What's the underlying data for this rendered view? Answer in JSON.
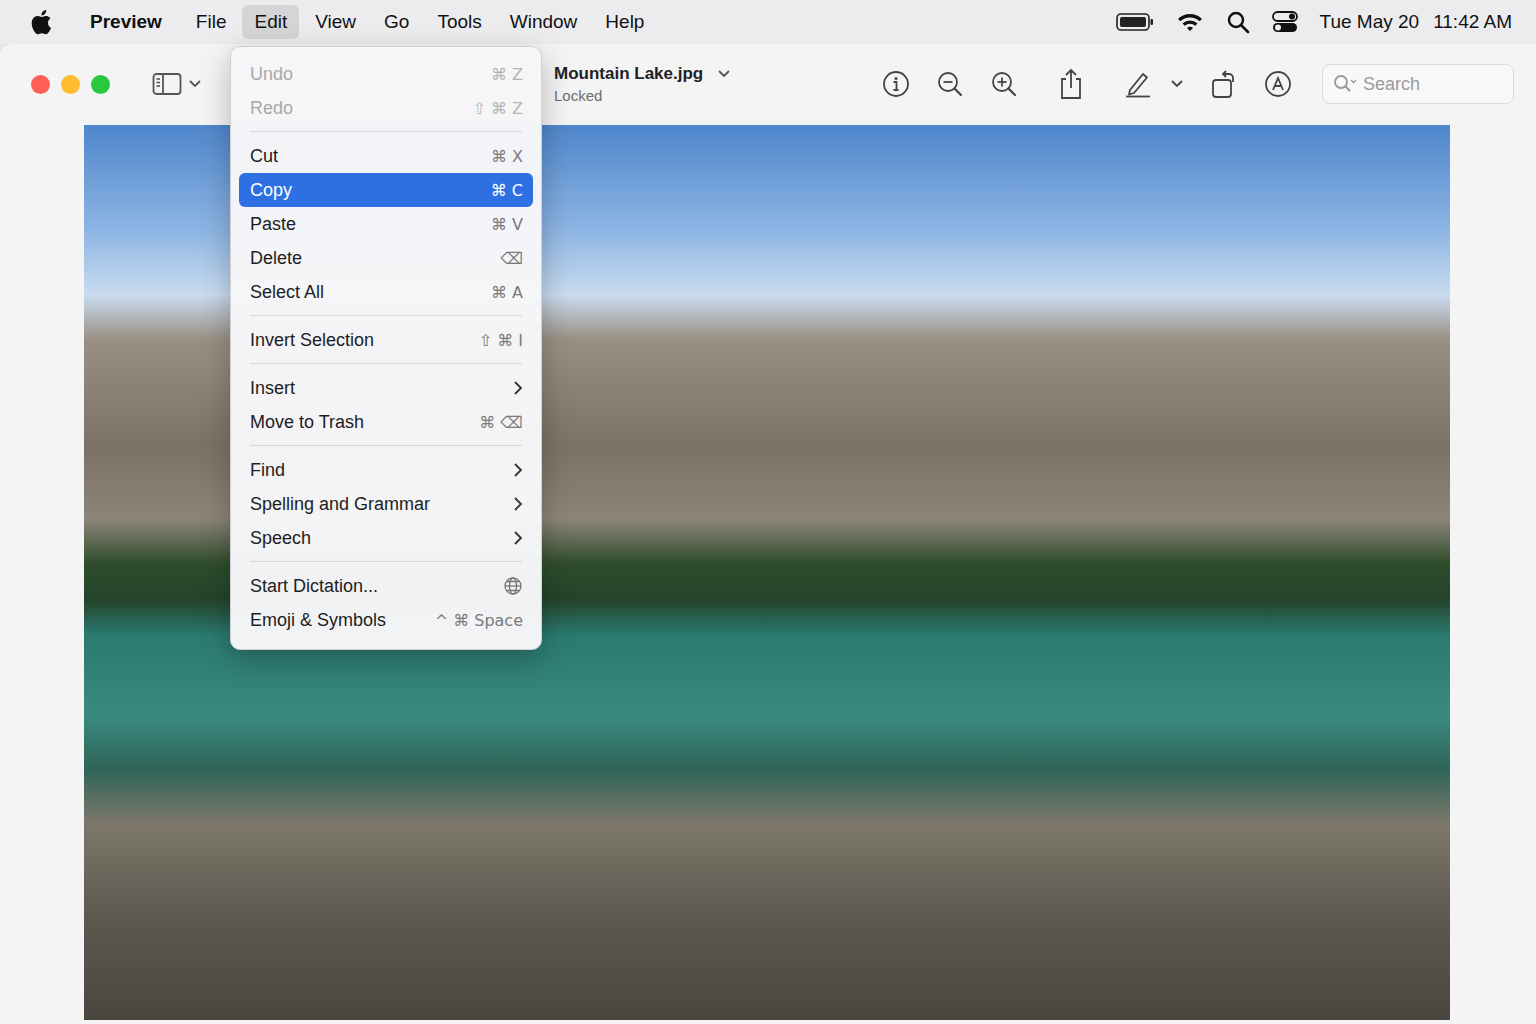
{
  "menubar": {
    "items": [
      {
        "label": "Preview",
        "bold": true,
        "selected": false
      },
      {
        "label": "File",
        "bold": false,
        "selected": false
      },
      {
        "label": "Edit",
        "bold": false,
        "selected": true
      },
      {
        "label": "View",
        "bold": false,
        "selected": false
      },
      {
        "label": "Go",
        "bold": false,
        "selected": false
      },
      {
        "label": "Tools",
        "bold": false,
        "selected": false
      },
      {
        "label": "Window",
        "bold": false,
        "selected": false
      },
      {
        "label": "Help",
        "bold": false,
        "selected": false
      }
    ],
    "date": "Tue May 20",
    "time": "11:42 AM"
  },
  "window": {
    "title": "Mountain Lake.jpg",
    "subtitle": "Locked"
  },
  "search": {
    "placeholder": "Search"
  },
  "menu": {
    "groups": [
      [
        {
          "label": "Undo",
          "shortcut": "⌘ Z",
          "kind": "shortcut",
          "disabled": true,
          "selected": false
        },
        {
          "label": "Redo",
          "shortcut": "⇧ ⌘ Z",
          "kind": "shortcut",
          "disabled": true,
          "selected": false
        }
      ],
      [
        {
          "label": "Cut",
          "shortcut": "⌘ X",
          "kind": "shortcut",
          "disabled": false,
          "selected": false
        },
        {
          "label": "Copy",
          "shortcut": "⌘ C",
          "kind": "shortcut",
          "disabled": false,
          "selected": true
        },
        {
          "label": "Paste",
          "shortcut": "⌘ V",
          "kind": "shortcut",
          "disabled": false,
          "selected": false
        },
        {
          "label": "Delete",
          "shortcut": "⌫",
          "kind": "shortcut",
          "disabled": false,
          "selected": false
        },
        {
          "label": "Select All",
          "shortcut": "⌘ A",
          "kind": "shortcut",
          "disabled": false,
          "selected": false
        }
      ],
      [
        {
          "label": "Invert Selection",
          "shortcut": "⇧ ⌘ I",
          "kind": "shortcut",
          "disabled": false,
          "selected": false
        }
      ],
      [
        {
          "label": "Insert",
          "shortcut": "",
          "kind": "submenu",
          "disabled": false,
          "selected": false
        },
        {
          "label": "Move to Trash",
          "shortcut": "⌘ ⌫",
          "kind": "shortcut",
          "disabled": false,
          "selected": false
        }
      ],
      [
        {
          "label": "Find",
          "shortcut": "",
          "kind": "submenu",
          "disabled": false,
          "selected": false
        },
        {
          "label": "Spelling and Grammar",
          "shortcut": "",
          "kind": "submenu",
          "disabled": false,
          "selected": false
        },
        {
          "label": "Speech",
          "shortcut": "",
          "kind": "submenu",
          "disabled": false,
          "selected": false
        }
      ],
      [
        {
          "label": "Start Dictation...",
          "shortcut": "",
          "kind": "globe",
          "disabled": false,
          "selected": false
        },
        {
          "label": "Emoji & Symbols",
          "shortcut": "^ ⌘ Space",
          "kind": "shortcut",
          "disabled": false,
          "selected": false
        }
      ]
    ]
  }
}
